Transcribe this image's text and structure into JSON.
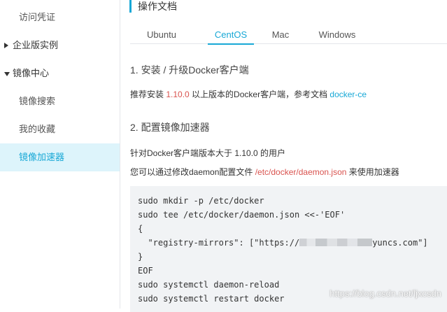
{
  "sidebar": {
    "items": [
      {
        "label": "访问凭证",
        "kind": "sub"
      },
      {
        "label": "企业版实例",
        "kind": "group",
        "caret": "right"
      },
      {
        "label": "镜像中心",
        "kind": "group",
        "caret": "down"
      },
      {
        "label": "镜像搜索",
        "kind": "sub"
      },
      {
        "label": "我的收藏",
        "kind": "sub"
      },
      {
        "label": "镜像加速器",
        "kind": "sub",
        "active": true
      }
    ]
  },
  "header": {
    "title": "操作文档"
  },
  "tabs": [
    {
      "label": "Ubuntu"
    },
    {
      "label": "CentOS",
      "active": true
    },
    {
      "label": "Mac"
    },
    {
      "label": "Windows"
    }
  ],
  "section1": {
    "title": "1. 安装 / 升级Docker客户端",
    "text_prefix": "推荐安装 ",
    "version": "1.10.0",
    "text_mid": " 以上版本的Docker客户端，参考文档 ",
    "link": "docker-ce"
  },
  "section2": {
    "title": "2. 配置镜像加速器",
    "line1": "针对Docker客户端版本大于 1.10.0 的用户",
    "line2_prefix": "您可以通过修改daemon配置文件 ",
    "line2_path": "/etc/docker/daemon.json",
    "line2_suffix": " 来使用加速器"
  },
  "code": {
    "line1": "sudo mkdir -p /etc/docker",
    "line2": "sudo tee /etc/docker/daemon.json <<-'EOF'",
    "line3": "{",
    "line4_prefix": "  \"registry-mirrors\": [\"https://",
    "line4_suffix": "yuncs.com\"]",
    "line5": "}",
    "line6": "EOF",
    "line7": "sudo systemctl daemon-reload",
    "line8": "sudo systemctl restart docker"
  },
  "watermark": "https://blog.csdn.net/ljxcsdn",
  "colors": {
    "accent": "#18a8d6",
    "highlight": "#d9534f",
    "active_bg": "#ddf4fb"
  }
}
